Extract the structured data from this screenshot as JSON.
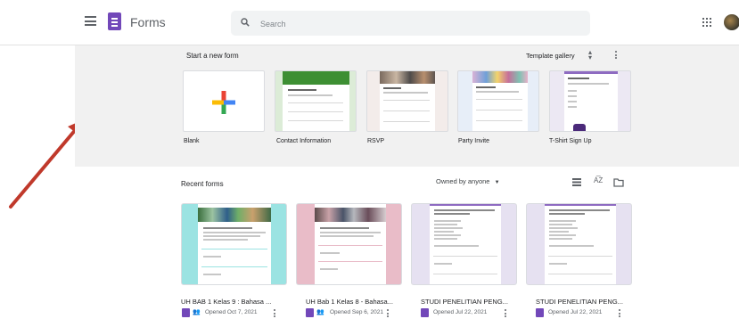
{
  "header": {
    "app_title": "Forms",
    "search_placeholder": "Search"
  },
  "templates": {
    "section_title": "Start a new form",
    "gallery_label": "Template gallery",
    "items": [
      {
        "label": "Blank"
      },
      {
        "label": "Contact Information"
      },
      {
        "label": "RSVP"
      },
      {
        "label": "Party Invite"
      },
      {
        "label": "T-Shirt Sign Up"
      }
    ]
  },
  "recent": {
    "section_title": "Recent forms",
    "owner_filter": "Owned by anyone",
    "items": [
      {
        "name": "UH BAB 1 Kelas 9 : Bahasa ...",
        "opened": "Opened Oct 7, 2021",
        "shared": true
      },
      {
        "name": "UH Bab 1 Kelas 8 - Bahasa...",
        "opened": "Opened Sep 6, 2021",
        "shared": true
      },
      {
        "name": "STUDI PENELITIAN PENG...",
        "opened": "Opened Jul 22, 2021",
        "shared": false
      },
      {
        "name": "STUDI PENELITIAN PENG...",
        "opened": "Opened Jul 22, 2021",
        "shared": false
      }
    ]
  },
  "colors": {
    "forms_brand": "#7248b9",
    "annotation_arrow": "#c0392b"
  },
  "icons": [
    "menu-icon",
    "forms-logo-icon",
    "search-icon",
    "apps-grid-icon",
    "unfold-icon",
    "more-vert-icon",
    "list-view-icon",
    "sort-az-icon",
    "folder-icon",
    "shared-people-icon"
  ]
}
